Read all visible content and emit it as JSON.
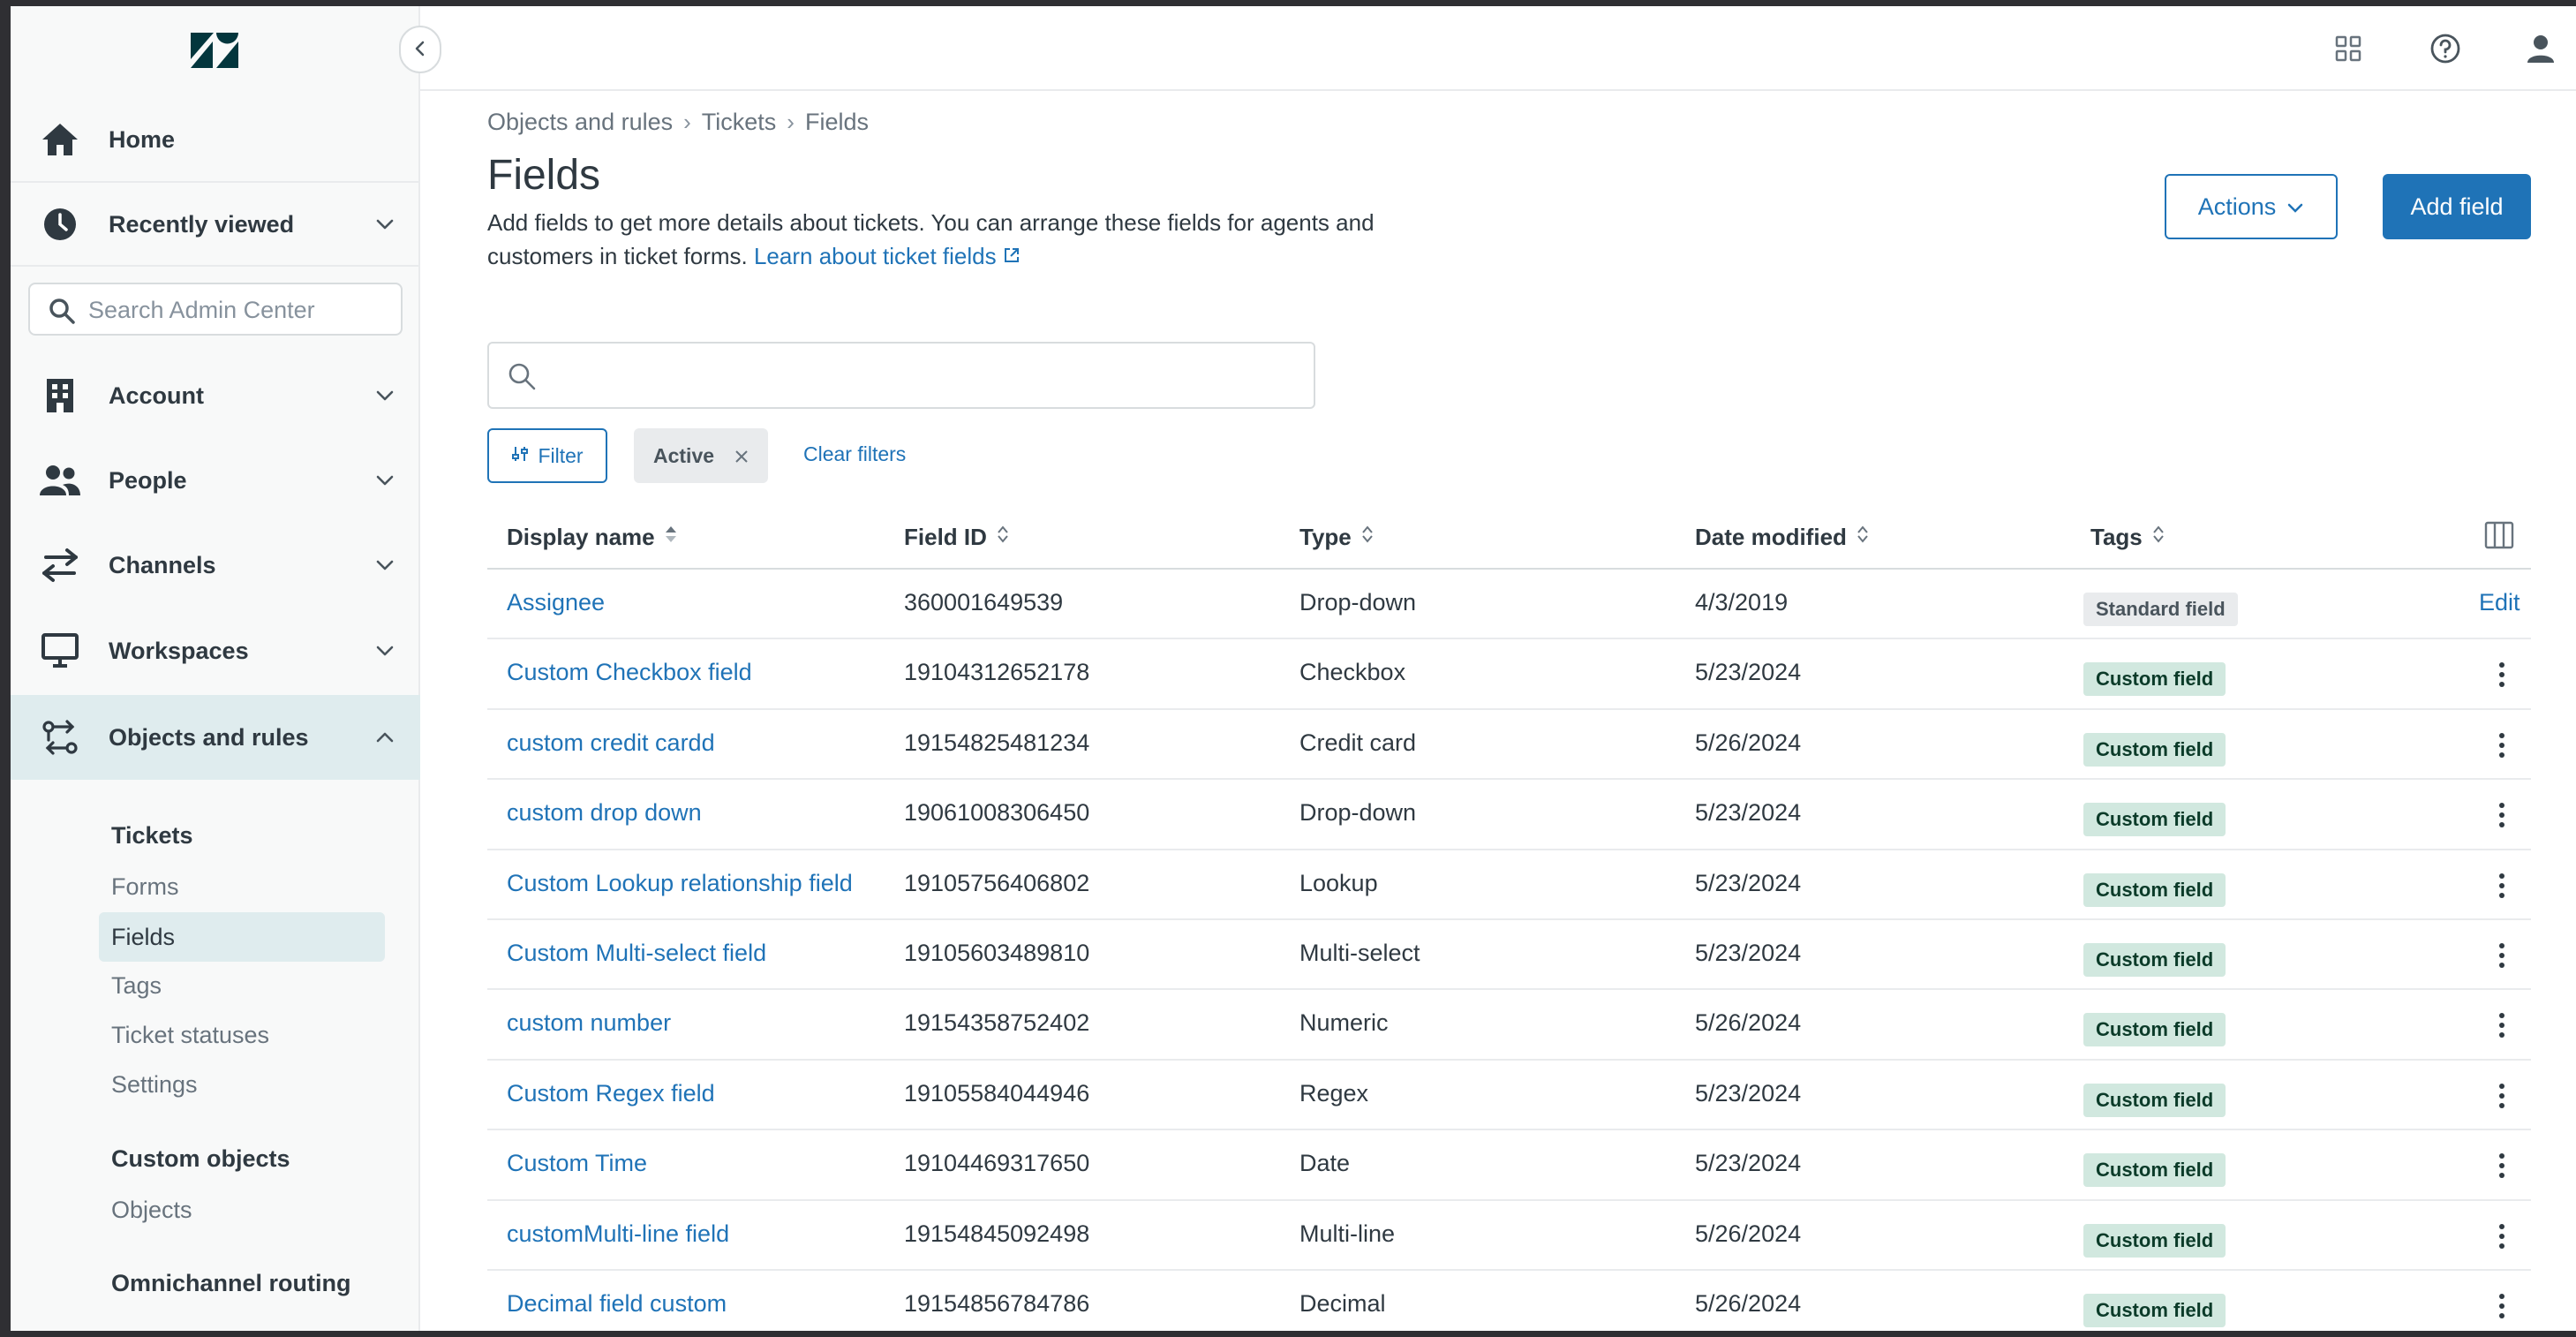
{
  "sidebar": {
    "collapse_icon": "chevron-left-icon",
    "nav": [
      {
        "label": "Home",
        "icon": "home-icon",
        "expandable": false
      },
      {
        "label": "Recently viewed",
        "icon": "clock-icon",
        "expandable": true
      },
      {
        "label": "Account",
        "icon": "building-icon",
        "expandable": true
      },
      {
        "label": "People",
        "icon": "people-icon",
        "expandable": true
      },
      {
        "label": "Channels",
        "icon": "arrows-icon",
        "expandable": true
      },
      {
        "label": "Workspaces",
        "icon": "monitor-icon",
        "expandable": true
      },
      {
        "label": "Objects and rules",
        "icon": "objects-icon",
        "expandable": true,
        "expanded": true
      }
    ],
    "search_placeholder": "Search Admin Center",
    "sub_sections": [
      {
        "heading": "Tickets",
        "items": [
          "Forms",
          "Fields",
          "Tags",
          "Ticket statuses",
          "Settings"
        ],
        "selected": "Fields"
      },
      {
        "heading": "Custom objects",
        "items": [
          "Objects"
        ]
      },
      {
        "heading": "Omnichannel routing",
        "items": []
      }
    ]
  },
  "topbar": {
    "icons": [
      "apps-grid-icon",
      "help-icon",
      "user-icon"
    ]
  },
  "breadcrumb": [
    "Objects and rules",
    "Tickets",
    "Fields"
  ],
  "page": {
    "title": "Fields",
    "description": "Add fields to get more details about tickets. You can arrange these fields for agents and customers in ticket forms.",
    "learn_link": "Learn about ticket fields",
    "actions_label": "Actions",
    "add_label": "Add field"
  },
  "filters": {
    "search_placeholder": "",
    "filter_label": "Filter",
    "active_chip": "Active",
    "clear_label": "Clear filters"
  },
  "table": {
    "columns": [
      "Display name",
      "Field ID",
      "Type",
      "Date modified",
      "Tags"
    ],
    "rows": [
      {
        "name": "Assignee",
        "id": "360001649539",
        "type": "Drop-down",
        "date": "4/3/2019",
        "tag": "Standard field",
        "action": "Edit"
      },
      {
        "name": "Custom Checkbox field",
        "id": "19104312652178",
        "type": "Checkbox",
        "date": "5/23/2024",
        "tag": "Custom field",
        "action": "menu"
      },
      {
        "name": "custom credit cardd",
        "id": "19154825481234",
        "type": "Credit card",
        "date": "5/26/2024",
        "tag": "Custom field",
        "action": "menu"
      },
      {
        "name": "custom drop down",
        "id": "19061008306450",
        "type": "Drop-down",
        "date": "5/23/2024",
        "tag": "Custom field",
        "action": "menu"
      },
      {
        "name": "Custom Lookup relationship field",
        "id": "19105756406802",
        "type": "Lookup",
        "date": "5/23/2024",
        "tag": "Custom field",
        "action": "menu"
      },
      {
        "name": "Custom Multi-select field",
        "id": "19105603489810",
        "type": "Multi-select",
        "date": "5/23/2024",
        "tag": "Custom field",
        "action": "menu"
      },
      {
        "name": "custom number",
        "id": "19154358752402",
        "type": "Numeric",
        "date": "5/26/2024",
        "tag": "Custom field",
        "action": "menu"
      },
      {
        "name": "Custom Regex field",
        "id": "19105584044946",
        "type": "Regex",
        "date": "5/23/2024",
        "tag": "Custom field",
        "action": "menu"
      },
      {
        "name": "Custom Time",
        "id": "19104469317650",
        "type": "Date",
        "date": "5/23/2024",
        "tag": "Custom field",
        "action": "menu"
      },
      {
        "name": "customMulti-line field",
        "id": "19154845092498",
        "type": "Multi-line",
        "date": "5/26/2024",
        "tag": "Custom field",
        "action": "menu"
      },
      {
        "name": "Decimal field custom",
        "id": "19154856784786",
        "type": "Decimal",
        "date": "5/26/2024",
        "tag": "Custom field",
        "action": "menu"
      }
    ]
  },
  "colors": {
    "primary": "#1f73b7",
    "sidebar_bg": "#f8f9f9",
    "selected_bg": "#dfecee",
    "custom_tag_bg": "#d1e8df",
    "standard_tag_bg": "#e9ebed"
  }
}
